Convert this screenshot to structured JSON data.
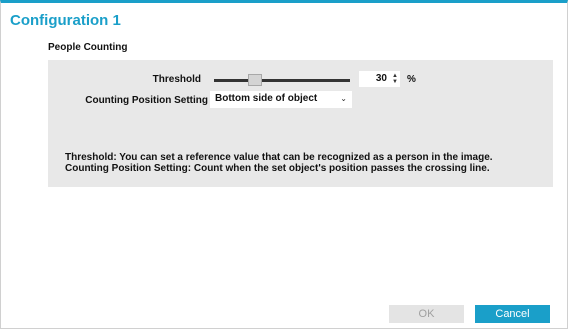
{
  "dialog": {
    "title": "Configuration 1",
    "section": "People Counting"
  },
  "threshold": {
    "label": "Threshold",
    "value": "30",
    "unit": "%",
    "slider_position": 0.3
  },
  "counting_position": {
    "label": "Counting Position Setting",
    "selected": "Bottom side of object"
  },
  "description": {
    "line1": "Threshold: You can set a reference value that can be recognized as a person in the image.",
    "line2": "Counting Position Setting: Count when the set object's position passes the crossing line."
  },
  "buttons": {
    "ok": "OK",
    "cancel": "Cancel"
  },
  "colors": {
    "accent": "#1a9fc9",
    "panel": "#e8e8e8"
  }
}
